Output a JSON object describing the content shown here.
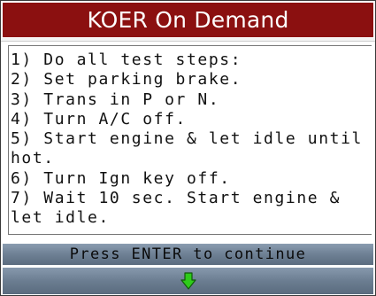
{
  "screen": {
    "title": "KOER On Demand",
    "steps": [
      "1) Do all test steps:",
      "2) Set parking brake.",
      "3) Trans in P or N.",
      "4) Turn A/C off.",
      "5) Start engine & let idle until hot.",
      "6) Turn Ign key off.",
      "7) Wait 10 sec. Start engine & let idle."
    ],
    "prompt": "Press ENTER to continue",
    "nav_icon": "down-arrow-icon"
  },
  "colors": {
    "title_bar": "#8b1010",
    "title_text": "#ffffff",
    "bar_gradient": "#6e8094",
    "arrow": "#2ecc1a"
  }
}
